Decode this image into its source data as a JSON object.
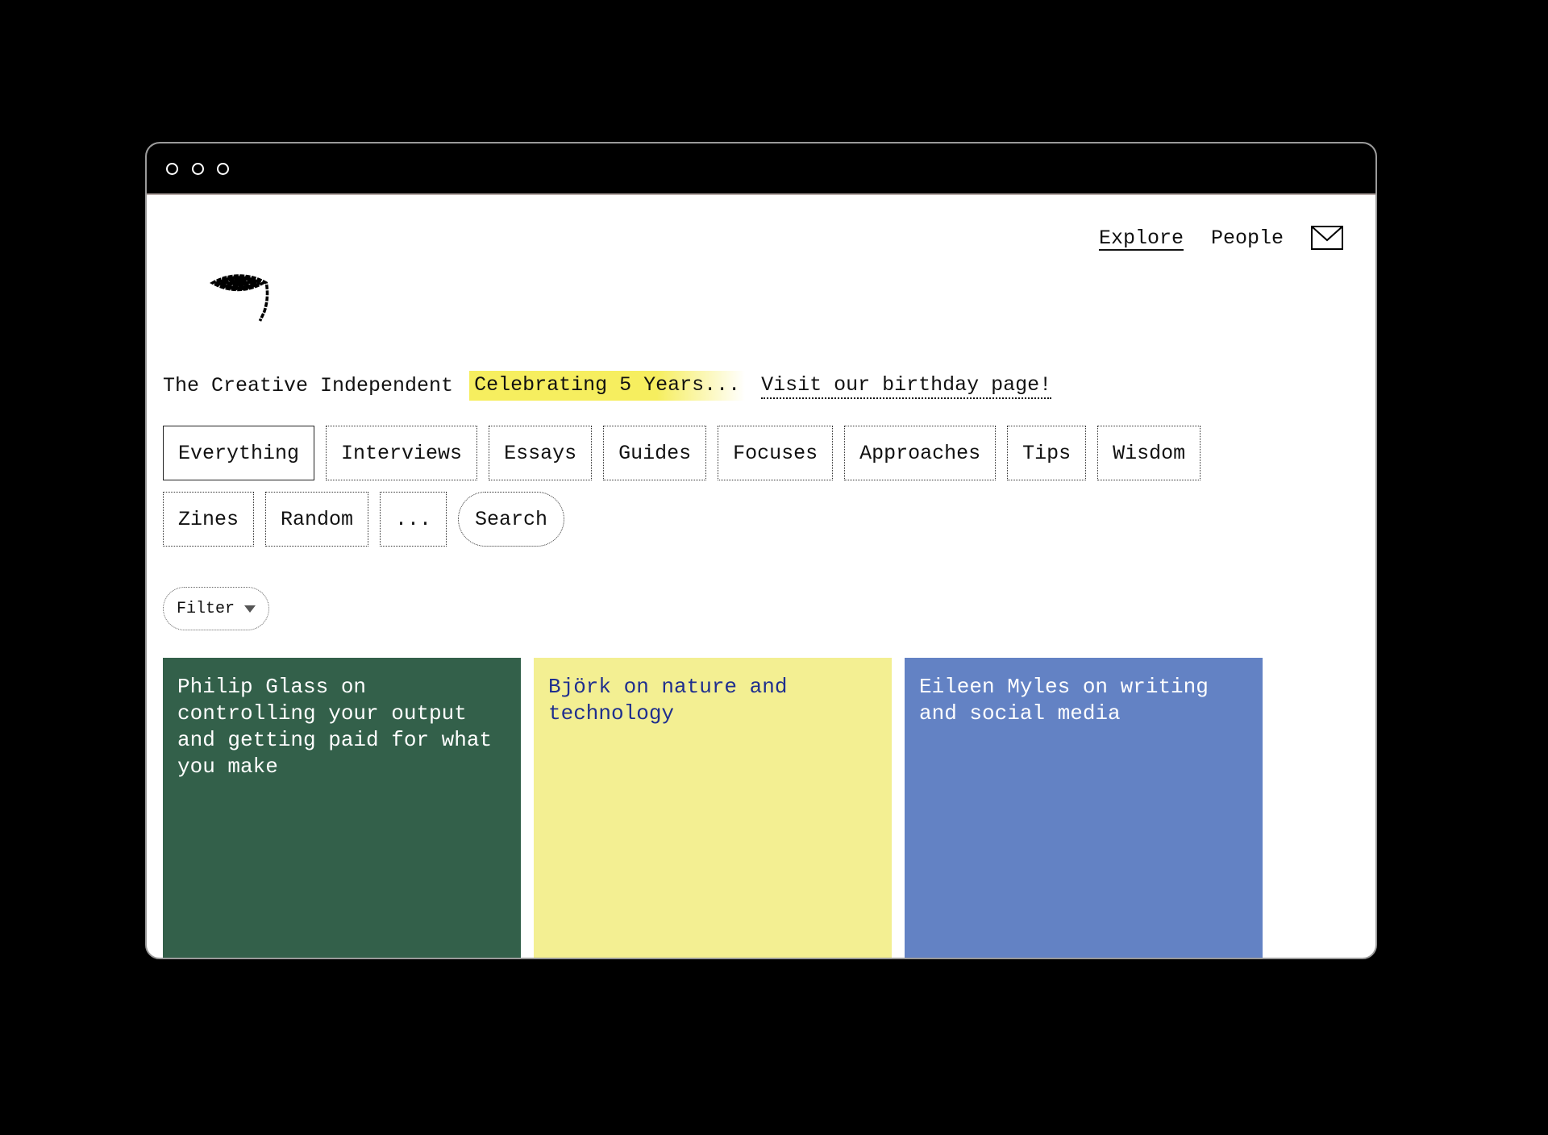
{
  "window": {
    "controls": [
      "close",
      "minimize",
      "maximize"
    ]
  },
  "header": {
    "logo_icon": "spiral-icon",
    "nav": [
      {
        "label": "Explore",
        "active": true
      },
      {
        "label": "People",
        "active": false
      }
    ],
    "mail_icon": "envelope-icon"
  },
  "tagline": {
    "site_name": "The Creative Independent",
    "highlight": "Celebrating 5 Years...",
    "link": "Visit our birthday page!",
    "highlight_color": "#f6ee5f"
  },
  "tabs": {
    "row1": [
      "Everything",
      "Interviews",
      "Essays",
      "Guides",
      "Focuses",
      "Approaches",
      "Tips",
      "Wisdom"
    ],
    "row2": [
      "Zines",
      "Random",
      "...",
      "Search"
    ],
    "active": "Everything"
  },
  "filter": {
    "label": "Filter",
    "icon": "caret-down-icon"
  },
  "cards": [
    {
      "title": "Philip Glass on controlling your output and getting paid for what you make",
      "color": "#33604a"
    },
    {
      "title": "Björk on nature and technology",
      "color": "#f3ef92"
    },
    {
      "title": "Eileen Myles on writing and social media",
      "color": "#6382c4"
    }
  ]
}
